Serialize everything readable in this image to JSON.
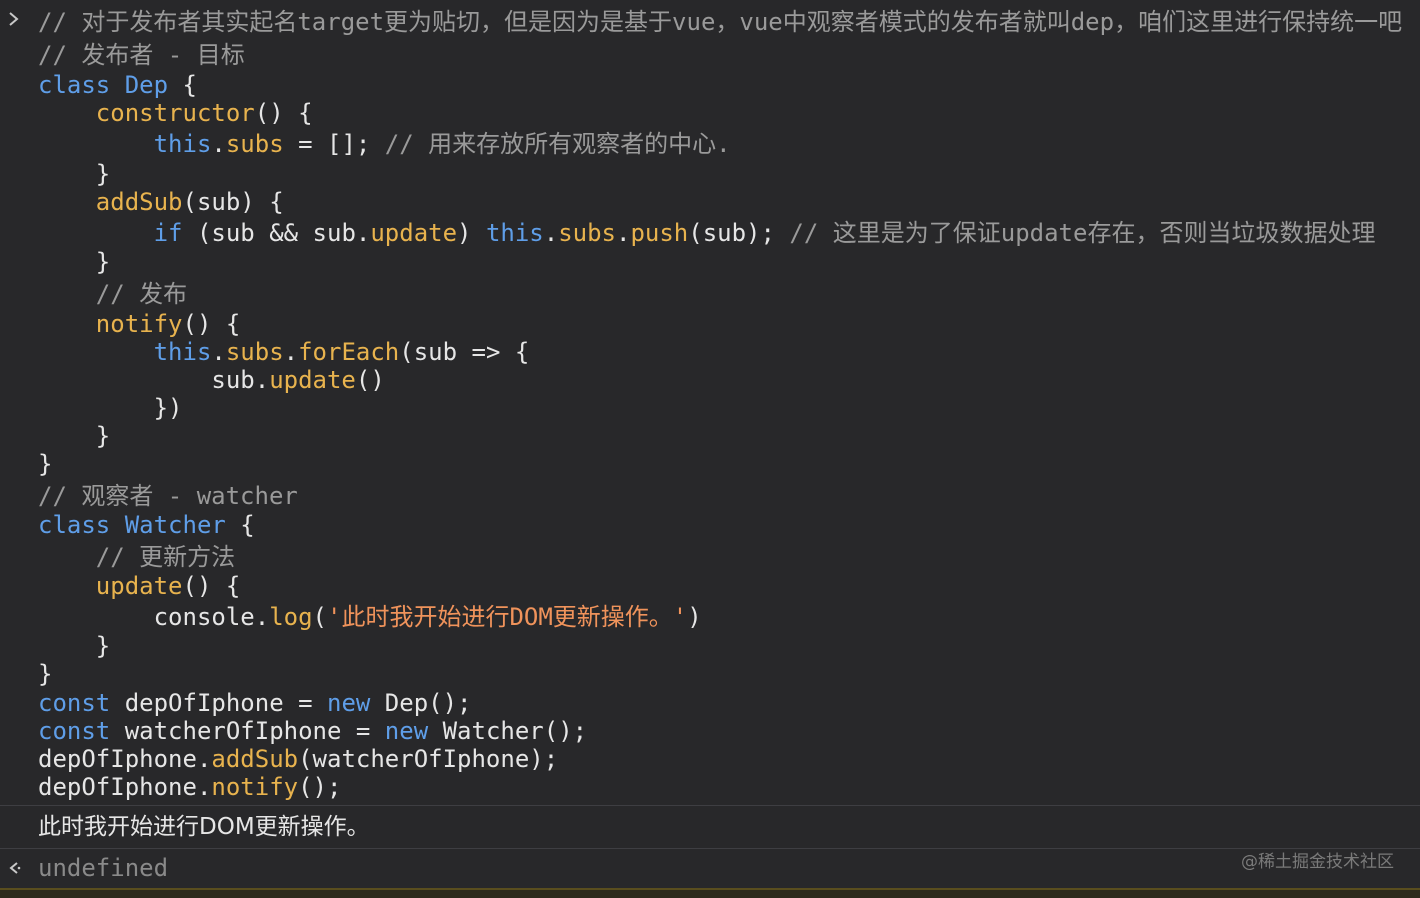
{
  "code_lines": [
    [
      [
        "comment",
        "// 对于发布者其实起名target更为贴切，但是因为是基于vue，vue中观察者模式的发布者就叫dep，咱们这里进行保持统一吧"
      ]
    ],
    [
      [
        "comment",
        "// 发布者 - 目标"
      ]
    ],
    [
      [
        "keyword",
        "class "
      ],
      [
        "class",
        "Dep"
      ],
      [
        "plain",
        " {"
      ]
    ],
    [
      [
        "plain",
        "    "
      ],
      [
        "method",
        "constructor"
      ],
      [
        "plain",
        "() {"
      ]
    ],
    [
      [
        "plain",
        "        "
      ],
      [
        "this",
        "this"
      ],
      [
        "plain",
        "."
      ],
      [
        "prop",
        "subs"
      ],
      [
        "plain",
        " = []; "
      ],
      [
        "comment",
        "// 用来存放所有观察者的中心."
      ]
    ],
    [
      [
        "plain",
        "    }"
      ]
    ],
    [
      [
        "plain",
        "    "
      ],
      [
        "method",
        "addSub"
      ],
      [
        "plain",
        "(sub) {"
      ]
    ],
    [
      [
        "plain",
        "        "
      ],
      [
        "keyword",
        "if"
      ],
      [
        "plain",
        " (sub && sub."
      ],
      [
        "prop",
        "update"
      ],
      [
        "plain",
        ") "
      ],
      [
        "this",
        "this"
      ],
      [
        "plain",
        "."
      ],
      [
        "prop",
        "subs"
      ],
      [
        "plain",
        "."
      ],
      [
        "method",
        "push"
      ],
      [
        "plain",
        "(sub); "
      ],
      [
        "comment",
        "// 这里是为了保证update存在，否则当垃圾数据处理"
      ]
    ],
    [
      [
        "plain",
        "    }"
      ]
    ],
    [
      [
        "plain",
        "    "
      ],
      [
        "comment",
        "// 发布"
      ]
    ],
    [
      [
        "plain",
        "    "
      ],
      [
        "method",
        "notify"
      ],
      [
        "plain",
        "() {"
      ]
    ],
    [
      [
        "plain",
        "        "
      ],
      [
        "this",
        "this"
      ],
      [
        "plain",
        "."
      ],
      [
        "prop",
        "subs"
      ],
      [
        "plain",
        "."
      ],
      [
        "method",
        "forEach"
      ],
      [
        "plain",
        "(sub => {"
      ]
    ],
    [
      [
        "plain",
        "            sub."
      ],
      [
        "method",
        "update"
      ],
      [
        "plain",
        "()"
      ]
    ],
    [
      [
        "plain",
        "        })"
      ]
    ],
    [
      [
        "plain",
        "    }"
      ]
    ],
    [
      [
        "plain",
        "}"
      ]
    ],
    [
      [
        "comment",
        "// 观察者 - watcher"
      ]
    ],
    [
      [
        "keyword",
        "class "
      ],
      [
        "class",
        "Watcher"
      ],
      [
        "plain",
        " {"
      ]
    ],
    [
      [
        "plain",
        "    "
      ],
      [
        "comment",
        "// 更新方法"
      ]
    ],
    [
      [
        "plain",
        "    "
      ],
      [
        "method",
        "update"
      ],
      [
        "plain",
        "() {"
      ]
    ],
    [
      [
        "plain",
        "        console."
      ],
      [
        "method",
        "log"
      ],
      [
        "plain",
        "("
      ],
      [
        "string",
        "'此时我开始进行DOM更新操作。'"
      ],
      [
        "plain",
        ")"
      ]
    ],
    [
      [
        "plain",
        "    }"
      ]
    ],
    [
      [
        "plain",
        "}"
      ]
    ],
    [
      [
        "keyword",
        "const"
      ],
      [
        "plain",
        " depOfIphone = "
      ],
      [
        "keyword",
        "new"
      ],
      [
        "plain",
        " Dep();"
      ]
    ],
    [
      [
        "keyword",
        "const"
      ],
      [
        "plain",
        " watcherOfIphone = "
      ],
      [
        "keyword",
        "new"
      ],
      [
        "plain",
        " Watcher();"
      ]
    ],
    [
      [
        "plain",
        "depOfIphone."
      ],
      [
        "method",
        "addSub"
      ],
      [
        "plain",
        "(watcherOfIphone);"
      ]
    ],
    [
      [
        "plain",
        "depOfIphone."
      ],
      [
        "method",
        "notify"
      ],
      [
        "plain",
        "();"
      ]
    ]
  ],
  "console_output": {
    "log_message": "此时我开始进行DOM更新操作。",
    "result_value": "undefined"
  },
  "watermark": "@稀土掘金技术社区",
  "icons": {
    "input_prompt": "chevron-right-icon",
    "result_prompt": "return-arrow-icon"
  },
  "colors": {
    "background": "#28282a",
    "keyword": "#5f9ee8",
    "method": "#e8b34e",
    "comment": "#9a9a9a",
    "string": "#f0935b",
    "text": "#e6e6e6"
  }
}
